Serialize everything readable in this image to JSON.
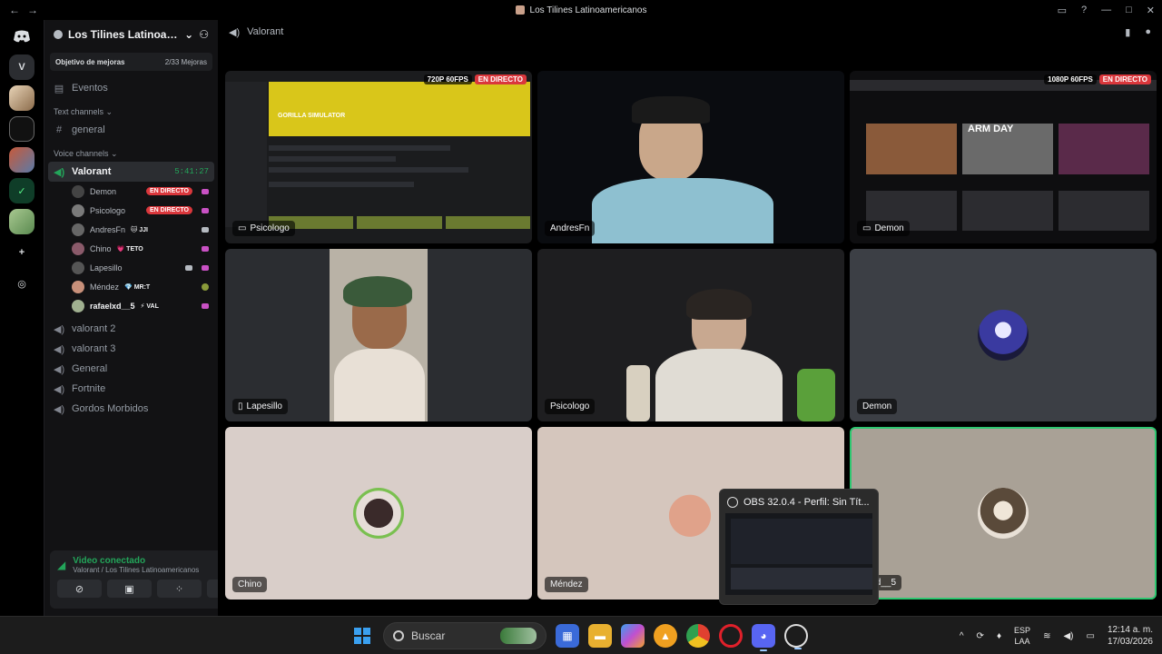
{
  "window": {
    "title": "Los Tilines Latinoamericanos",
    "nav_back": "←",
    "nav_forward": "→"
  },
  "rail": {
    "home_letter": "V"
  },
  "guild": {
    "name": "Los Tilines Latinoameri...",
    "boost_label": "Objetivo de mejoras",
    "boost_progress": "2/33 Mejoras",
    "events_label": "Eventos",
    "text_category": "Text channels",
    "text_channels": [
      "general"
    ],
    "voice_category": "Voice channels",
    "active_voice": {
      "name": "Valorant",
      "timer": "5:41:27"
    },
    "voice_users": [
      {
        "name": "Demon",
        "tag": "",
        "live": "EN DIRECTO"
      },
      {
        "name": "Psicologo",
        "tag": "",
        "live": "EN DIRECTO"
      },
      {
        "name": "AndresFn",
        "tag": "🐱 JJI",
        "live": ""
      },
      {
        "name": "Chino",
        "tag": "💗 TETO",
        "live": ""
      },
      {
        "name": "Lapesillo",
        "tag": "",
        "live": ""
      },
      {
        "name": "Méndez",
        "tag": "💎 MR:T",
        "live": ""
      },
      {
        "name": "rafaelxd__5",
        "tag": "⚡ VAL",
        "live": ""
      }
    ],
    "other_voice_channels": [
      "valorant 2",
      "valorant 3",
      "General",
      "Fortnite",
      "Gordos Morbidos"
    ]
  },
  "userpanel": {
    "status": "Video conectado",
    "location": "Valorant / Los Tilines Latinoamericanos"
  },
  "main": {
    "channel_name": "Valorant",
    "tiles": [
      {
        "label": "Psicologo",
        "quality": "720P 60FPS",
        "live": "EN DIRECTO"
      },
      {
        "label": "AndresFn"
      },
      {
        "label": "Demon",
        "quality": "1080P 60FPS",
        "live": "EN DIRECTO"
      },
      {
        "label": "Lapesillo"
      },
      {
        "label": "Psicologo"
      },
      {
        "label": "Demon"
      },
      {
        "label": "Chino"
      },
      {
        "label": "Méndez"
      },
      {
        "label": "elxd__5"
      }
    ],
    "stream1_title": "GORILLA SIMULATOR",
    "stream2_title": "ARM DAY"
  },
  "obs_popup": {
    "title": "OBS 32.0.4 - Perfil: Sin Tít..."
  },
  "taskbar": {
    "search_placeholder": "Buscar",
    "lang_top": "ESP",
    "lang_bottom": "LAA",
    "time": "12:14 a. m.",
    "date": "17/03/2026"
  },
  "colors": {
    "accent_green": "#23a55a",
    "live_red": "#da373c",
    "windows_blue": "#3aa0f0"
  }
}
